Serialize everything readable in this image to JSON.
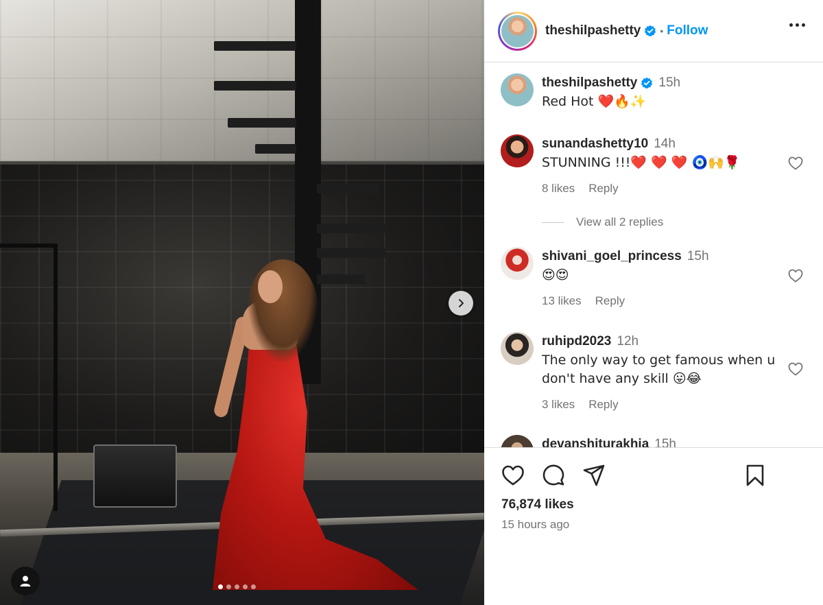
{
  "post": {
    "owner": "theshilpashetty",
    "follow_label": "Follow",
    "separator": "•",
    "likes": "76,874 likes",
    "posted_ago": "15 hours ago",
    "carousel_slides": 5,
    "carousel_active": 1
  },
  "caption": {
    "username": "theshilpashetty",
    "time": "15h",
    "text": "Red Hot ❤️🔥✨"
  },
  "comments": [
    {
      "username": "sunandashetty10",
      "time": "14h",
      "text": "STUNNING !!!❤️ ❤️ ❤️ 🧿🙌🌹",
      "likes": "8 likes",
      "reply_label": "Reply",
      "view_replies": "View all 2 replies"
    },
    {
      "username": "shivani_goel_princess",
      "time": "15h",
      "text": "😍😍",
      "likes": "13 likes",
      "reply_label": "Reply"
    },
    {
      "username": "ruhipd2023",
      "time": "12h",
      "text": "The only way to get famous when u don't have any skill 😛😂",
      "likes": "3 likes",
      "reply_label": "Reply"
    },
    {
      "username": "devanshiturakhia",
      "time": "15h"
    }
  ],
  "icons": {
    "verified": "verified-badge-icon",
    "more": "more-options-icon",
    "like": "heart-icon",
    "comment": "comment-icon",
    "share": "share-icon",
    "save": "bookmark-icon",
    "next": "chevron-right-icon",
    "tag": "user-tag-icon"
  },
  "colors": {
    "link_blue": "#0095f6",
    "verified_blue": "#0095f6",
    "muted": "#737373",
    "text": "#262626",
    "divider": "#dbdbdb"
  }
}
